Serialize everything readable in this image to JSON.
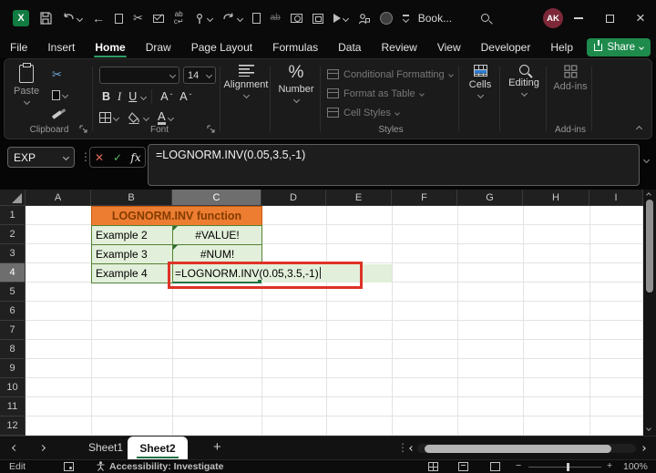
{
  "titlebar": {
    "title": "Book...",
    "avatar_initials": "AK",
    "qat_icons": [
      "excel-logo",
      "save",
      "undo",
      "back",
      "copy",
      "cut",
      "mail",
      "translate",
      "touch-mode",
      "redo",
      "new-document",
      "strikethrough",
      "camera",
      "snapshot-preview",
      "export-run",
      "sign-in-lock",
      "account-circle",
      "customize-qat",
      "search",
      "minimize",
      "maximize",
      "close"
    ]
  },
  "menu": {
    "tabs": [
      {
        "label": "File"
      },
      {
        "label": "Insert"
      },
      {
        "label": "Home"
      },
      {
        "label": "Draw"
      },
      {
        "label": "Page Layout"
      },
      {
        "label": "Formulas"
      },
      {
        "label": "Data"
      },
      {
        "label": "Review"
      },
      {
        "label": "View"
      },
      {
        "label": "Developer"
      },
      {
        "label": "Help"
      }
    ],
    "active_tab": "Home",
    "share": {
      "label": "Share"
    }
  },
  "ribbon": {
    "clipboard": {
      "paste": "Paste",
      "group": "Clipboard"
    },
    "font": {
      "size": "14",
      "bold": "B",
      "italic": "I",
      "underline": "U",
      "group": "Font"
    },
    "alignment": {
      "label": "Alignment"
    },
    "number": {
      "label": "Number",
      "symbol": "%"
    },
    "styles": {
      "items": [
        {
          "label": "Conditional Formatting"
        },
        {
          "label": "Format as Table"
        },
        {
          "label": "Cell Styles"
        }
      ],
      "group": "Styles"
    },
    "cells": {
      "label": "Cells"
    },
    "editing": {
      "label": "Editing"
    },
    "addins": {
      "label": "Add-ins",
      "group": "Add-ins"
    }
  },
  "formula_bar": {
    "name_box_value": "EXP",
    "fx_label": "fx",
    "formula": "=LOGNORM.INV(0.05,3.5,-1)"
  },
  "grid": {
    "columns": [
      "A",
      "B",
      "C",
      "D",
      "E",
      "F",
      "G",
      "H",
      "I"
    ],
    "rows": [
      "1",
      "2",
      "3",
      "4",
      "5",
      "6",
      "7",
      "8",
      "9",
      "10",
      "11",
      "12"
    ],
    "active_column": "C",
    "active_row": "4",
    "cells": {
      "title": "LOGNORM.INV function",
      "example2_label": "Example 2",
      "example2_value": "#VALUE!",
      "example3_label": "Example 3",
      "example3_value": "#NUM!",
      "example4_label": "Example 4",
      "example4_formula": "=LOGNORM.INV(0.05,3.5,-1)"
    }
  },
  "sheets": {
    "tabs": [
      {
        "name": "Sheet1"
      },
      {
        "name": "Sheet2"
      }
    ],
    "active": "Sheet2",
    "new_sheet_label": "+"
  },
  "status": {
    "mode": "Edit",
    "accessibility": "Accessibility: Investigate",
    "zoom_level": "100%"
  },
  "colors": {
    "excel_green": "#107C41",
    "share_green": "#1E8A4C",
    "home_underline": "#2E9D62",
    "orange_fill": "#ED7D31",
    "orange_text": "#833C00",
    "light_green_fill": "#E2EFDA",
    "green_border": "#548235",
    "annotation_red": "#DE3226",
    "avatar_bg": "#7D2838",
    "selected_header_gray": "#6E6E6E"
  }
}
